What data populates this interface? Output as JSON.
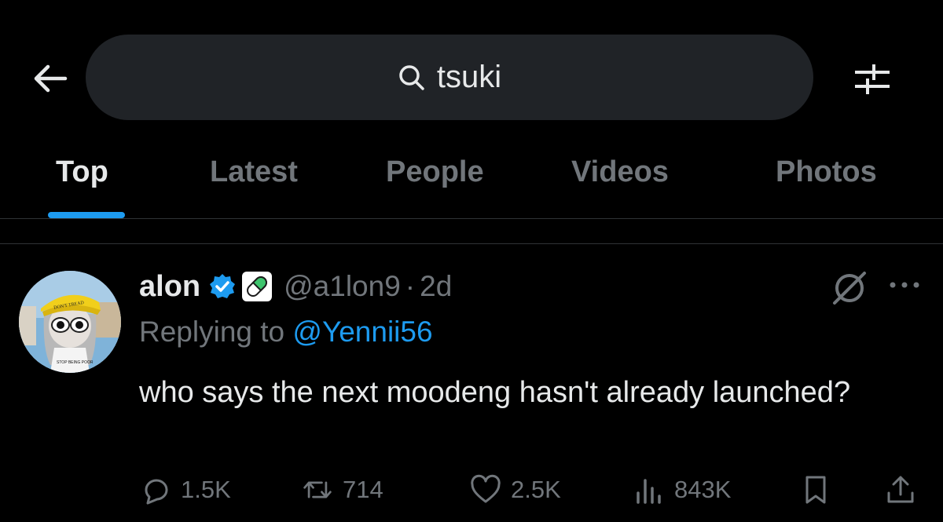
{
  "search": {
    "query": "tsuki"
  },
  "tabs": [
    {
      "label": "Top",
      "active": true
    },
    {
      "label": "Latest",
      "active": false
    },
    {
      "label": "People",
      "active": false
    },
    {
      "label": "Videos",
      "active": false
    },
    {
      "label": "Photos",
      "active": false
    }
  ],
  "tweet": {
    "display_name": "alon",
    "handle": "@a1lon9",
    "separator": "·",
    "time": "2d",
    "replying_prefix": "Replying to ",
    "replying_to": "@Yennii56",
    "text": "who says the next moodeng hasn't already launched?",
    "avatar_text": {
      "cap": "DON'T TREAD",
      "shirt": "STOP BEING POOR"
    },
    "actions": {
      "replies": "1.5K",
      "reposts": "714",
      "likes": "2.5K",
      "views": "843K"
    }
  },
  "colors": {
    "background": "#000000",
    "search_bg": "#202327",
    "text_primary": "#e7e9ea",
    "text_secondary": "#71767b",
    "accent": "#1d9bf0",
    "verified_badge": "#1d9bf0",
    "pill_green": "#3ec46d"
  },
  "icons": [
    "back-arrow-icon",
    "search-icon",
    "filter-sliders-icon",
    "verified-badge-icon",
    "pill-badge-icon",
    "grok-icon",
    "more-icon",
    "reply-icon",
    "repost-icon",
    "like-icon",
    "views-icon",
    "bookmark-icon",
    "share-icon"
  ]
}
